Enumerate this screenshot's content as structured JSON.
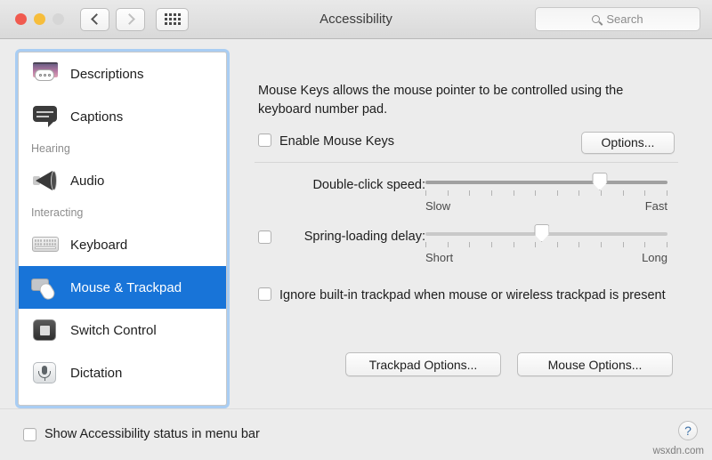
{
  "window": {
    "title": "Accessibility",
    "traffic_lights": [
      "close",
      "minimize",
      "zoom"
    ],
    "nav": {
      "back": "back-chevron",
      "forward": "forward-chevron",
      "grid": "show-all-grid"
    },
    "search": {
      "placeholder": "Search",
      "value": "",
      "icon": "search-icon"
    }
  },
  "sidebar": {
    "items": [
      {
        "label": "Descriptions",
        "icon": "descriptions-icon",
        "type": "item",
        "selected": false
      },
      {
        "label": "Captions",
        "icon": "captions-icon",
        "type": "item",
        "selected": false
      },
      {
        "label": "Hearing",
        "type": "group"
      },
      {
        "label": "Audio",
        "icon": "audio-icon",
        "type": "item",
        "selected": false
      },
      {
        "label": "Interacting",
        "type": "group"
      },
      {
        "label": "Keyboard",
        "icon": "keyboard-icon",
        "type": "item",
        "selected": false
      },
      {
        "label": "Mouse & Trackpad",
        "icon": "mouse-trackpad-icon",
        "type": "item",
        "selected": true
      },
      {
        "label": "Switch Control",
        "icon": "switch-control-icon",
        "type": "item",
        "selected": false
      },
      {
        "label": "Dictation",
        "icon": "dictation-icon",
        "type": "item",
        "selected": false
      }
    ]
  },
  "main": {
    "description": "Mouse Keys allows the mouse pointer to be controlled using the keyboard number pad.",
    "enable_mouse_keys": {
      "label": "Enable Mouse Keys",
      "checked": false
    },
    "options_button": "Options...",
    "double_click": {
      "label": "Double-click speed:",
      "min_label": "Slow",
      "max_label": "Fast",
      "value_percent": 72,
      "tick_count": 12,
      "enabled": true
    },
    "spring_loading": {
      "label": "Spring-loading delay:",
      "min_label": "Short",
      "max_label": "Long",
      "value_percent": 48,
      "tick_count": 12,
      "checked": false,
      "enabled": false
    },
    "ignore_trackpad": {
      "label": "Ignore built-in trackpad when mouse or wireless trackpad is present",
      "checked": false
    },
    "trackpad_options_button": "Trackpad Options...",
    "mouse_options_button": "Mouse Options..."
  },
  "footer": {
    "show_status": {
      "label": "Show Accessibility status in menu bar",
      "checked": false
    },
    "help_button": "?",
    "watermark": "wsxdn.com"
  },
  "colors": {
    "selection_blue": "#1874d8",
    "focus_ring": "#a9cdf3",
    "window_bg": "#ececec",
    "help_blue": "#3a6ea5"
  }
}
